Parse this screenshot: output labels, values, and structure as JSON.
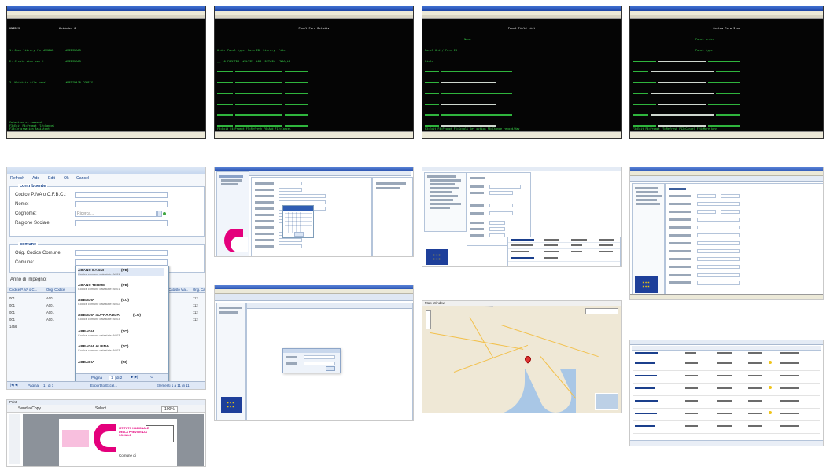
{
  "terminals": [
    {
      "header": [
        "UNIDES",
        "Unidades 0"
      ],
      "lines": [
        "1. Open library for #UNIAR       #MEDINAJR",
        "2. Create wide swh H             #MEDINAJR",
        "3. Maintain file panel           #MEDINAJR CONFIG"
      ],
      "footer": [
        "Selection or command",
        "F3=Exit   F4=Prompt   F12=Cancel",
        "F13=Information Assistant"
      ],
      "status": [
        "MW",
        "05/020"
      ]
    },
    {
      "header": [
        "Panel Form Details"
      ],
      "lines": [
        "Order Panel type  Form ID  Library  File",
        "__ 10 FORMPDS  #ULTIM  LDS  DETAIL  FNDA_LE",
        "Records by Form Type"
      ],
      "footer": [
        "F3=Exit  F4=Prompt  F5=Refresh  F6=Add  F12=Cancel"
      ],
      "status": [
        "MW",
        "09/020"
      ]
    },
    {
      "header": [
        "Panel Field List",
        "Name",
        "Panel Ord / Form ID"
      ],
      "lines": [
        "Field",
        "Seq By",
        "Data Pos  Field List"
      ],
      "footer": [
        "F3=Exit  F4=Prompt  F5=Scroll Key option  F6=Change record/Key"
      ],
      "status": [
        "MW",
        "07/013"
      ]
    },
    {
      "header": [
        "Custom Form Item",
        "Panel order",
        "Panel type",
        "Form ID"
      ],
      "lines": [
        "Field",
        "Header",
        "Form Group",
        "Label"
      ],
      "footer": [
        "F3=Exit  F4=Prompt  F5=Refresh  F12=Cancel  F24=More keys"
      ],
      "status": [
        "MW",
        "05/020"
      ]
    }
  ],
  "form": {
    "toolbar": [
      "Refresh",
      "Add",
      "Edit",
      "Ok",
      "Cancel"
    ],
    "section_contributor": "contribuente",
    "fields": [
      {
        "label": "Codice P.IVA o C.F.B.C.:",
        "value": ""
      },
      {
        "label": "Nome:",
        "value": ""
      },
      {
        "label": "Cognome:",
        "value": "Ricerca..."
      },
      {
        "label": "Ragione Sociale:",
        "value": ""
      }
    ],
    "section_comune": "comune",
    "comune_fields": [
      {
        "label": "Orig. Codice Comune:",
        "value": ""
      },
      {
        "label": "Comune:",
        "value": ""
      }
    ],
    "anno_label": "Anno di impegno:",
    "dropdown": [
      {
        "name": "ABANO BAGNI",
        "prov": "(PD)",
        "sub": "Codice comune catastale: A001"
      },
      {
        "name": "ABANO TERME",
        "prov": "(PD)",
        "sub": "Codice comune catastale: A001"
      },
      {
        "name": "ABBADIA",
        "prov": "(CO)",
        "sub": "Codice comune catastale: A002"
      },
      {
        "name": "ABBADIA SOPRA ADDA",
        "prov": "(CO)",
        "sub": "Codice comune catastale: A003"
      },
      {
        "name": "ABBADIA",
        "prov": "(TO)",
        "sub": "Codice comune catastale: A003"
      },
      {
        "name": "ABBADIA ALPINA",
        "prov": "(TO)",
        "sub": "Codice comune catastale: A003"
      },
      {
        "name": "ABBADIA",
        "prov": "(RI)",
        "sub": ""
      }
    ],
    "grid_headers": [
      "Codice P.IVA o C...",
      "Orig. Codice",
      "Orig. Catasto Via...",
      "Orig. Ca"
    ],
    "grid_rows": [
      [
        "001",
        "A001",
        "",
        "112"
      ],
      [
        "001",
        "A001",
        "",
        "112"
      ],
      [
        "001",
        "A001",
        "",
        "112"
      ],
      [
        "001",
        "A001",
        "",
        "112"
      ],
      [
        "1456",
        "",
        "",
        ""
      ]
    ],
    "dropdown_pager": [
      "Pagina",
      "1",
      "di 2"
    ],
    "pager": [
      "Pagina",
      "1",
      "di 1"
    ],
    "export_label": "Export to Excel...",
    "record_count": "Elementi 1 a 11 di 11"
  },
  "brand": {
    "magenta": "#e4007c",
    "eu_blue": "#1e3f9a",
    "eu_yellow": "#ffd200",
    "terminal_green": "#39d24a"
  },
  "preview": {
    "title": "Print",
    "toolbar": [
      "Send a Copy",
      "Select",
      "100%"
    ],
    "brand_lines": [
      "ISTITUTO NAZIONALE",
      "DELLA PREVIDENZA",
      "SOCIALE"
    ],
    "doc_label": "Comune di"
  },
  "map": {
    "title": "Map Window"
  }
}
